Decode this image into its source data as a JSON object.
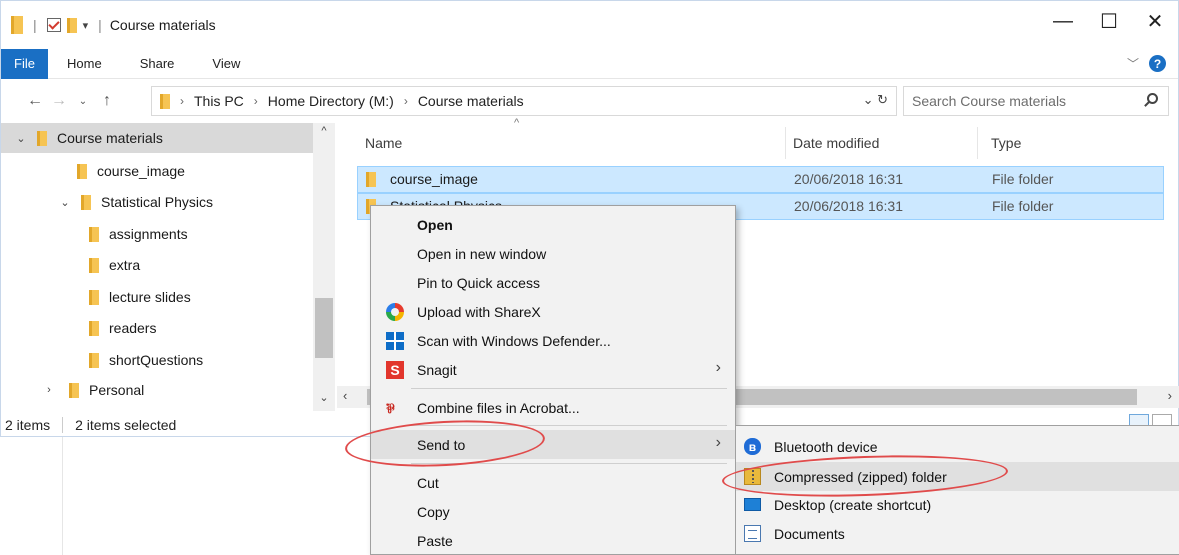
{
  "window": {
    "title": "Course materials",
    "controls": {
      "minimize": "—",
      "maximize": "☐",
      "close": "✕"
    }
  },
  "ribbon": {
    "tabs": [
      "File",
      "Home",
      "Share",
      "View"
    ]
  },
  "address": {
    "crumbs": [
      "This PC",
      "Home Directory (M:)",
      "Course materials"
    ],
    "search_placeholder": "Search Course materials"
  },
  "nav_pane": {
    "items": [
      {
        "label": "Course materials",
        "expanded": true,
        "selected": true
      },
      {
        "label": "course_image"
      },
      {
        "label": "Statistical Physics",
        "expanded": true
      },
      {
        "label": "assignments"
      },
      {
        "label": "extra"
      },
      {
        "label": "lecture slides"
      },
      {
        "label": "readers"
      },
      {
        "label": "shortQuestions"
      },
      {
        "label": "Personal",
        "expanded": false
      }
    ]
  },
  "file_list": {
    "columns": [
      "Name",
      "Date modified",
      "Type"
    ],
    "rows": [
      {
        "name": "course_image",
        "date": "20/06/2018 16:31",
        "type": "File folder"
      },
      {
        "name": "Statistical Physics",
        "date": "20/06/2018 16:31",
        "type": "File folder"
      }
    ]
  },
  "status_bar": {
    "count": "2 items",
    "selection": "2 items selected"
  },
  "context_menu": {
    "items": [
      {
        "label": "Open",
        "bold": true
      },
      {
        "label": "Open in new window"
      },
      {
        "label": "Pin to Quick access"
      },
      {
        "label": "Upload with ShareX",
        "icon": "sharex-icon"
      },
      {
        "label": "Scan with Windows Defender...",
        "icon": "windows-defender-icon"
      },
      {
        "label": "Snagit",
        "icon": "snagit-icon",
        "submenu": true
      },
      {
        "label": "Combine files in Acrobat...",
        "icon": "acrobat-icon"
      },
      {
        "label": "Send to",
        "submenu": true,
        "highlighted": true
      },
      {
        "label": "Cut"
      },
      {
        "label": "Copy"
      },
      {
        "label": "Paste"
      }
    ]
  },
  "send_to_menu": {
    "items": [
      {
        "label": "Bluetooth device",
        "icon": "bluetooth-icon"
      },
      {
        "label": "Compressed (zipped) folder",
        "icon": "zip-folder-icon",
        "highlighted": true
      },
      {
        "label": "Desktop (create shortcut)",
        "icon": "desktop-icon"
      },
      {
        "label": "Documents",
        "icon": "documents-icon"
      }
    ]
  },
  "colors": {
    "accent": "#1a6fc4",
    "selection": "#cce8ff",
    "annotation": "#e04b4b",
    "folder": "#f6c453"
  }
}
